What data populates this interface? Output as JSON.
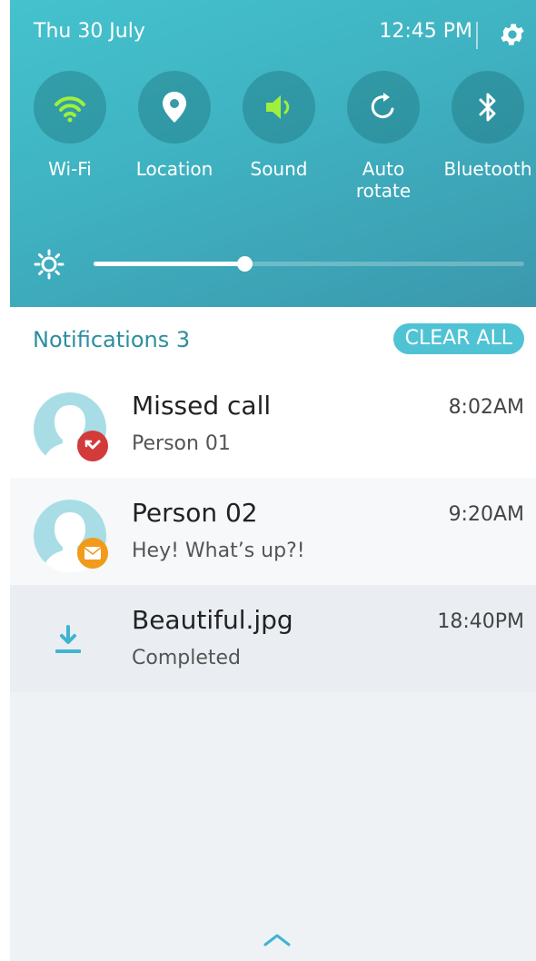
{
  "status": {
    "date": "Thu 30 July",
    "time": "12:45 PM",
    "settings_icon": "gear-icon"
  },
  "quick_settings": [
    {
      "label": "Wi-Fi",
      "icon": "wifi-icon",
      "active": true
    },
    {
      "label": "Location",
      "icon": "location-pin-icon",
      "active": false
    },
    {
      "label": "Sound",
      "icon": "speaker-icon",
      "active": true
    },
    {
      "label": "Auto rotate",
      "icon": "rotate-icon",
      "active": false
    },
    {
      "label": "Bluetooth",
      "icon": "bluetooth-icon",
      "active": false
    }
  ],
  "brightness": {
    "icon": "brightness-icon",
    "level": 0.35
  },
  "notifications": {
    "title": "Notifications 3",
    "clear_label": "CLEAR ALL",
    "items": [
      {
        "title": "Missed call",
        "subtitle": "Person 01",
        "time": "8:02AM",
        "icon": "missed-call-icon",
        "badge_color": "#d33a3a"
      },
      {
        "title": "Person 02",
        "subtitle": "Hey! What’s up?!",
        "time": "9:20AM",
        "icon": "message-icon",
        "badge_color": "#f29a1a"
      },
      {
        "title": "Beautiful.jpg",
        "subtitle": "Completed",
        "time": "18:40PM",
        "icon": "download-icon",
        "badge_color": ""
      }
    ]
  },
  "colors": {
    "accent": "#4fc3d4",
    "active_icon": "#9ef03c",
    "panel_top": "#44c2cd",
    "panel_bottom": "#3b98ad"
  },
  "footer": {
    "icon": "chevron-up-icon"
  }
}
